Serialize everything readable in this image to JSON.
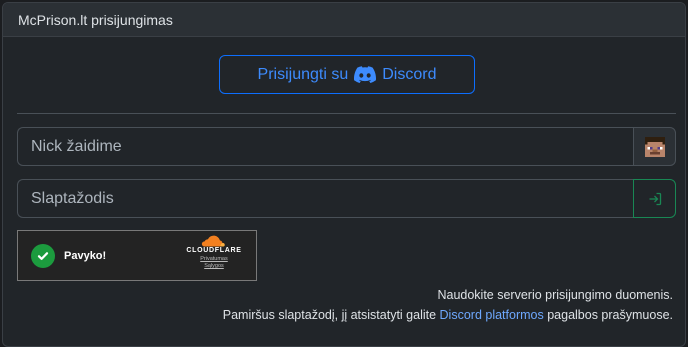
{
  "header": {
    "title": "McPrison.lt prisijungimas"
  },
  "discord_button": {
    "prefix": "Prisijungti su",
    "brand": "Discord",
    "icon": "discord-icon",
    "color": "#0d6efd"
  },
  "form": {
    "nick_placeholder": "Nick žaidime",
    "nick_icon": "minecraft-head-icon",
    "password_placeholder": "Slaptažodis",
    "submit_icon": "login-icon",
    "submit_color": "#198754"
  },
  "captcha": {
    "status": "Pavyko!",
    "brand": "CLOUDFLARE",
    "privacy_link": "Privatumas",
    "terms_link": "Sąlygos",
    "status_color": "#1c9b3e"
  },
  "info": {
    "line1": "Naudokite serverio prisijungimo duomenis.",
    "line2_pre": "Pamiršus slaptažodį, jį atsistatyti galite",
    "line2_link": "Discord platformos",
    "line2_post": "pagalbos prašymuose."
  }
}
